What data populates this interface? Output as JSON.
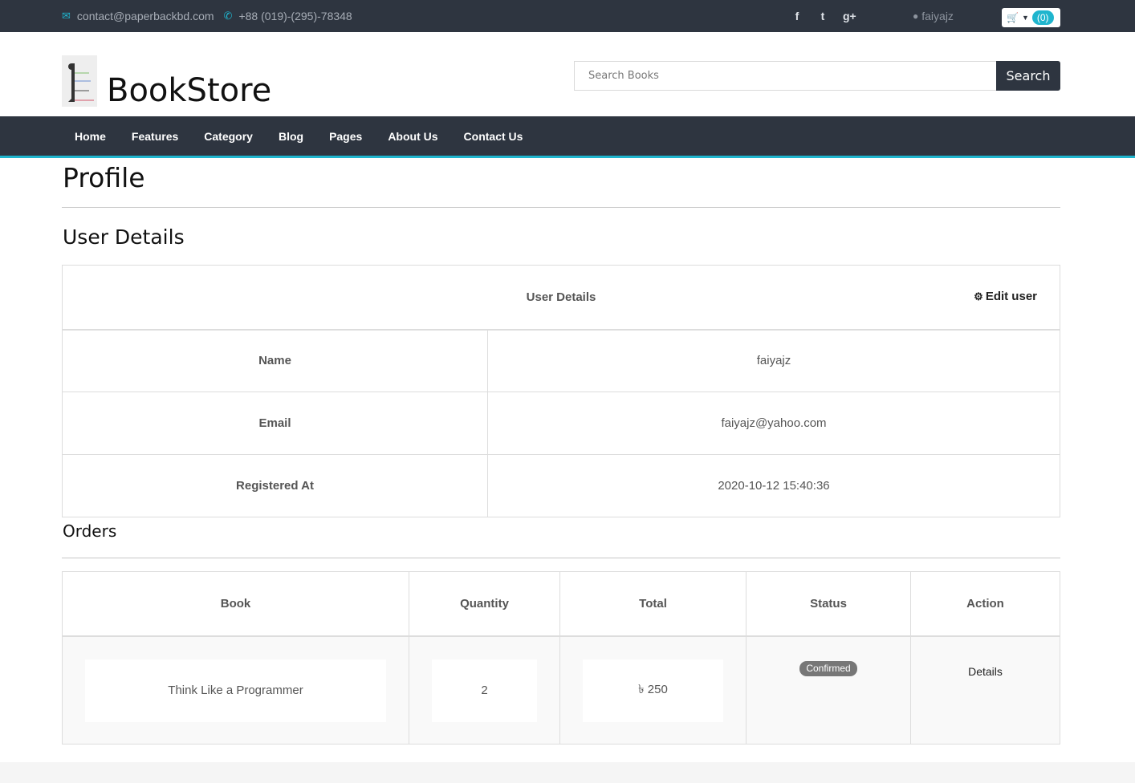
{
  "topbar": {
    "email": "contact@paperbackbd.com",
    "phone": "+88 (019)-(295)-78348",
    "username": "faiyajz",
    "cart_count": "(0)"
  },
  "header": {
    "brand": "BookStore",
    "search_placeholder": "Search Books",
    "search_button": "Search"
  },
  "nav": {
    "items": [
      "Home",
      "Features",
      "Category",
      "Blog",
      "Pages",
      "About Us",
      "Contact Us"
    ]
  },
  "main": {
    "page_title": "Profile",
    "section_title": "User Details",
    "user_table": {
      "header": "User Details",
      "edit_label": "Edit user",
      "rows": [
        {
          "label": "Name",
          "value": "faiyajz"
        },
        {
          "label": "Email",
          "value": "faiyajz@yahoo.com"
        },
        {
          "label": "Registered At",
          "value": "2020-10-12 15:40:36"
        }
      ]
    },
    "orders_title": "Orders",
    "orders_table": {
      "columns": [
        "Book",
        "Quantity",
        "Total",
        "Status",
        "Action"
      ],
      "rows": [
        {
          "book": "Think Like a Programmer",
          "quantity": "2",
          "total": "৳ 250",
          "status": "Confirmed",
          "action": "Details"
        }
      ]
    }
  },
  "colors": {
    "dark": "#2e3540",
    "accent": "#1fb5ce"
  }
}
